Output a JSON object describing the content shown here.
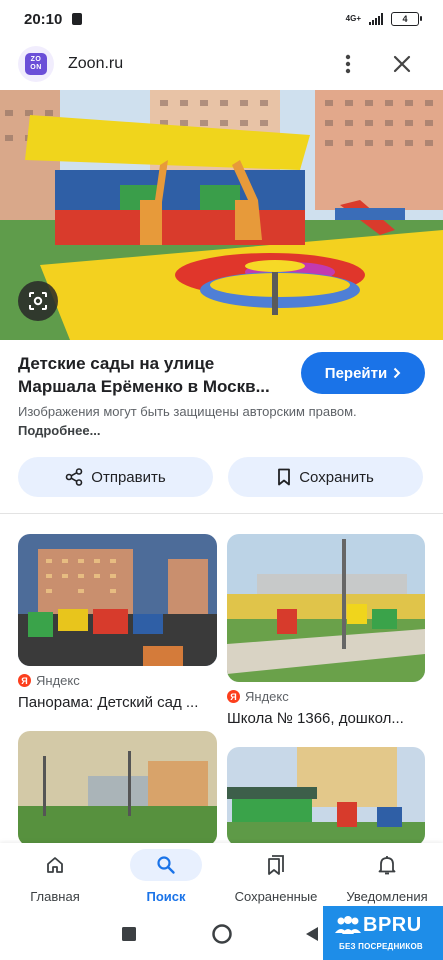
{
  "status_bar": {
    "time": "20:10",
    "network": "4G+",
    "battery": "4"
  },
  "header": {
    "site_name": "Zoon.ru",
    "logo_line1": "ZO",
    "logo_line2": "ON",
    "menu_icon": "more-vert-icon",
    "close_icon": "close-icon"
  },
  "hero": {
    "lens_icon": "lens-icon"
  },
  "result": {
    "title": "Детские сады на улице Маршала Ерёменко в Москв...",
    "go_label": "Перейти",
    "note": "Изображения могут быть защищены авторским правом.",
    "note_link": "Подробнее...",
    "share_label": "Отправить",
    "save_label": "Сохранить"
  },
  "related": [
    {
      "source": "Яндекс",
      "title": "Панорама: Детский сад ..."
    },
    {
      "source": "Яндекс",
      "title": "Школа № 1366, дошкол..."
    }
  ],
  "bottom_nav": [
    {
      "label": "Главная",
      "icon": "home-icon",
      "active": false
    },
    {
      "label": "Поиск",
      "icon": "search-icon",
      "active": true
    },
    {
      "label": "Сохраненные",
      "icon": "bookmarks-icon",
      "active": false
    },
    {
      "label": "Уведомления",
      "icon": "bell-icon",
      "active": false
    }
  ],
  "watermark": {
    "title": "BPRU",
    "subtitle": "БЕЗ ПОСРЕДНИКОВ"
  },
  "colors": {
    "accent": "#1a73e8",
    "accent_light": "#e8f0fe",
    "yandex": "#fc3f1d",
    "logo": "#6b4fd8"
  }
}
